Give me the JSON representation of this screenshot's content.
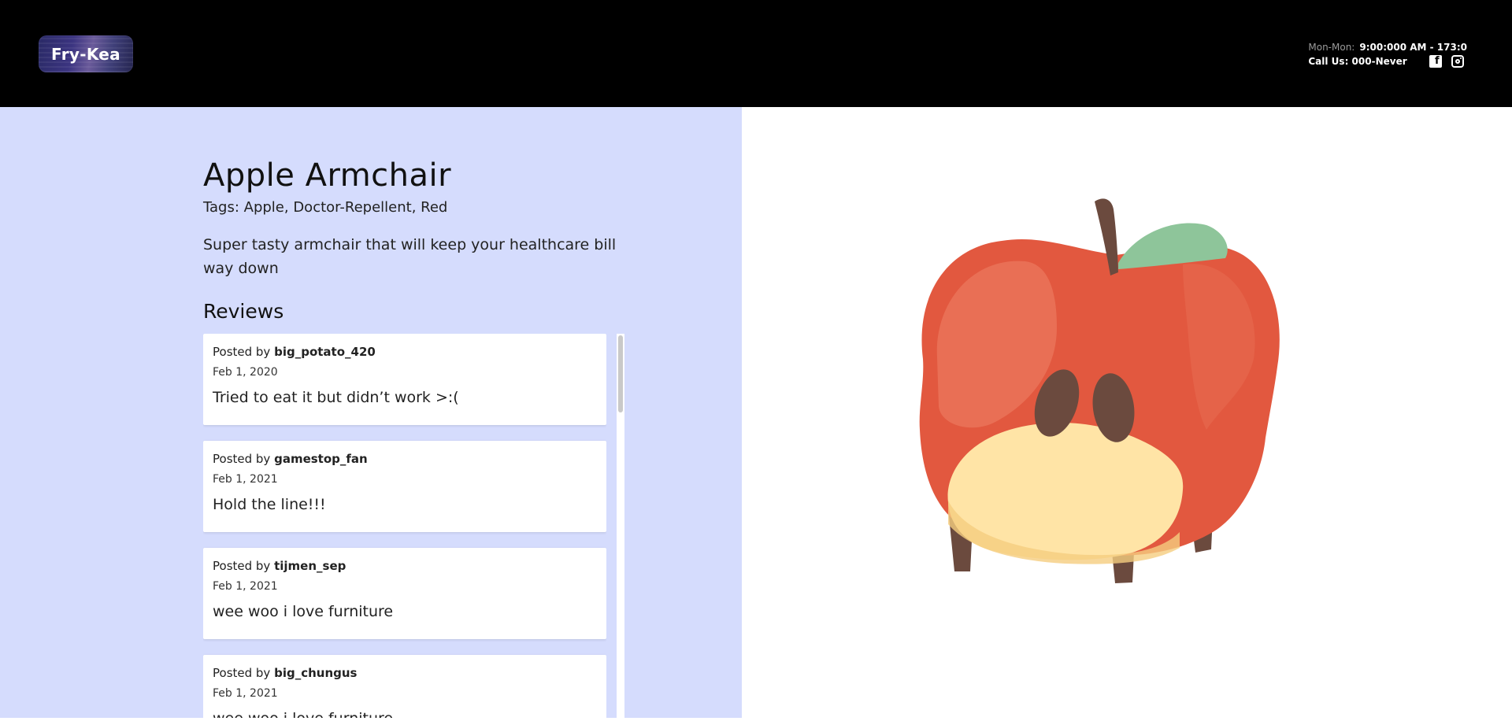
{
  "header": {
    "logo": "Fry-Kea",
    "hours_label": "Mon-Mon:",
    "hours_value": "9:00:000 AM - 173:0",
    "phone": "Call Us: 000-Never",
    "icons": [
      "facebook-icon",
      "instagram-icon"
    ]
  },
  "product": {
    "title": "Apple Armchair",
    "tags": "Tags: Apple, Doctor-Repellent, Red",
    "description": "Super tasty armchair that will keep your healthcare bill way down",
    "image_alt_icon": "apple-armchair-illustration"
  },
  "reviews": {
    "heading": "Reviews",
    "posted_by_prefix": "Posted by",
    "items": [
      {
        "user": "big_potato_420",
        "date": "Feb 1, 2020",
        "text": "Tried to eat it but didn’t work >:("
      },
      {
        "user": "gamestop_fan",
        "date": "Feb 1, 2021",
        "text": "Hold the line!!!"
      },
      {
        "user": "tijmen_sep",
        "date": "Feb 1, 2021",
        "text": "wee woo i love furniture"
      },
      {
        "user": "big_chungus",
        "date": "Feb 1, 2021",
        "text": "wee woo i love furniture"
      }
    ]
  },
  "colors": {
    "header_bg": "#000000",
    "left_panel_bg": "#d5dcfd",
    "apple_red": "#e2583f",
    "seat_cream": "#ffe4a6",
    "leaf_green": "#8ec59a",
    "wood_brown": "#6b4a3e"
  }
}
